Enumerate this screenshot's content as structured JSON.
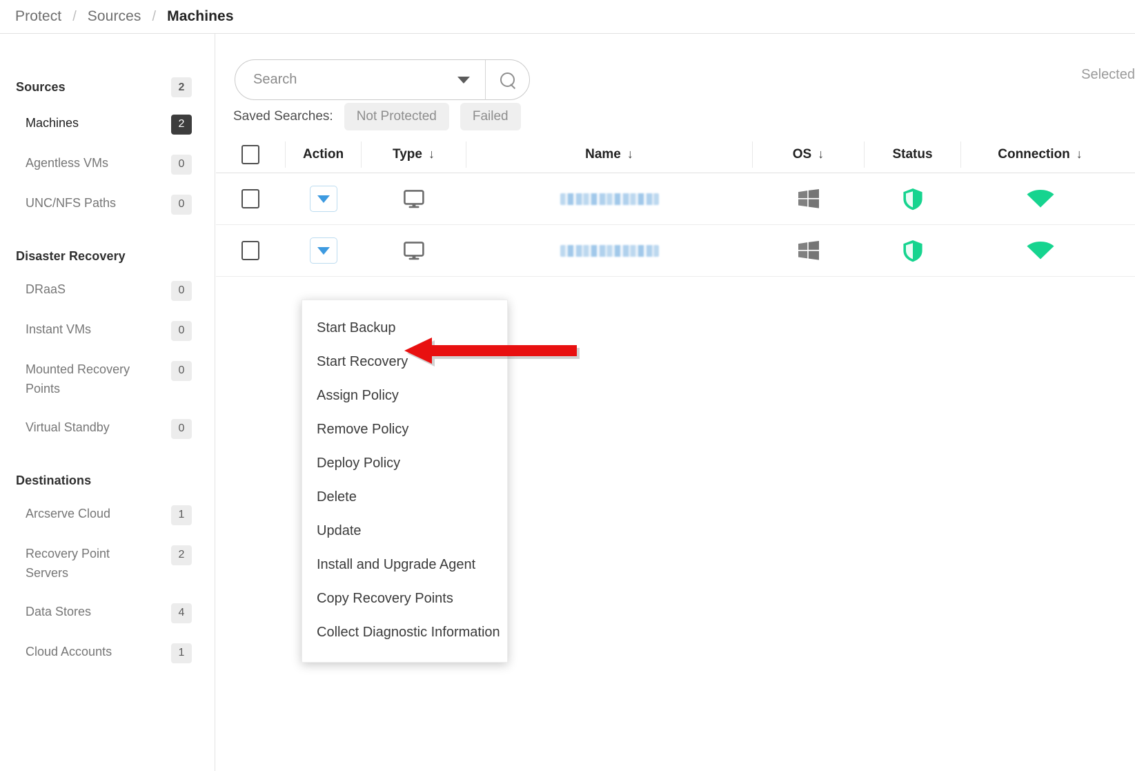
{
  "breadcrumb": {
    "items": [
      "Protect",
      "Sources",
      "Machines"
    ],
    "separator": "/"
  },
  "sidebar": {
    "groups": [
      {
        "title": "Sources",
        "title_badge": "2",
        "items": [
          {
            "label": "Machines",
            "badge": "2",
            "selected": true
          },
          {
            "label": "Agentless VMs",
            "badge": "0",
            "selected": false
          },
          {
            "label": "UNC/NFS Paths",
            "badge": "0",
            "selected": false
          }
        ]
      },
      {
        "title": "Disaster Recovery",
        "title_badge": "",
        "items": [
          {
            "label": "DRaaS",
            "badge": "0",
            "selected": false
          },
          {
            "label": "Instant VMs",
            "badge": "0",
            "selected": false
          },
          {
            "label": "Mounted Recovery Points",
            "badge": "0",
            "selected": false
          },
          {
            "label": "Virtual Standby",
            "badge": "0",
            "selected": false
          }
        ]
      },
      {
        "title": "Destinations",
        "title_badge": "",
        "items": [
          {
            "label": "Arcserve Cloud",
            "badge": "1",
            "selected": false
          },
          {
            "label": "Recovery Point Servers",
            "badge": "2",
            "selected": false
          },
          {
            "label": "Data Stores",
            "badge": "4",
            "selected": false
          },
          {
            "label": "Cloud Accounts",
            "badge": "1",
            "selected": false
          }
        ]
      }
    ]
  },
  "toolbar": {
    "search": {
      "value": "",
      "placeholder": "Search"
    },
    "search_icon": "search-icon",
    "dropdown_icon": "chevron-down-icon",
    "selected_label": "Selected",
    "saved_searches_label": "Saved Searches:",
    "saved_searches": [
      "Not Protected",
      "Failed"
    ]
  },
  "table": {
    "columns": [
      {
        "key": "check",
        "label": "",
        "sortable": false
      },
      {
        "key": "action",
        "label": "Action",
        "sortable": false
      },
      {
        "key": "type",
        "label": "Type",
        "sortable": true
      },
      {
        "key": "name",
        "label": "Name",
        "sortable": true
      },
      {
        "key": "os",
        "label": "OS",
        "sortable": true
      },
      {
        "key": "status",
        "label": "Status",
        "sortable": false
      },
      {
        "key": "conn",
        "label": "Connection",
        "sortable": true
      }
    ],
    "sort_glyph": "↓",
    "rows": [
      {
        "checked": false,
        "action_icon": "caret-down-icon",
        "type_icon": "monitor-icon",
        "name": "",
        "name_redacted": true,
        "os_icon": "windows-icon",
        "status_icon": "shield-protected-icon",
        "connection_icon": "wifi-connected-icon"
      },
      {
        "checked": false,
        "action_icon": "caret-down-icon",
        "type_icon": "monitor-icon",
        "name": "",
        "name_redacted": true,
        "os_icon": "windows-icon",
        "status_icon": "shield-protected-icon",
        "connection_icon": "wifi-connected-icon"
      }
    ]
  },
  "context_menu": {
    "items": [
      "Start Backup",
      "Start Recovery",
      "Assign Policy",
      "Remove Policy",
      "Deploy Policy",
      "Delete",
      "Update",
      "Install and Upgrade Agent",
      "Copy Recovery Points",
      "Collect Diagnostic Information"
    ]
  },
  "annotation": {
    "type": "arrow",
    "points_to": "Start Recovery",
    "direction": "left"
  },
  "colors": {
    "accent_blue": "#3d9ae0",
    "status_green": "#16d48f",
    "badge_selected_bg": "#3d3d3d",
    "badge_bg": "#ececec",
    "annotation_red": "#e81010",
    "redaction_blue": "#9cc6e9"
  }
}
